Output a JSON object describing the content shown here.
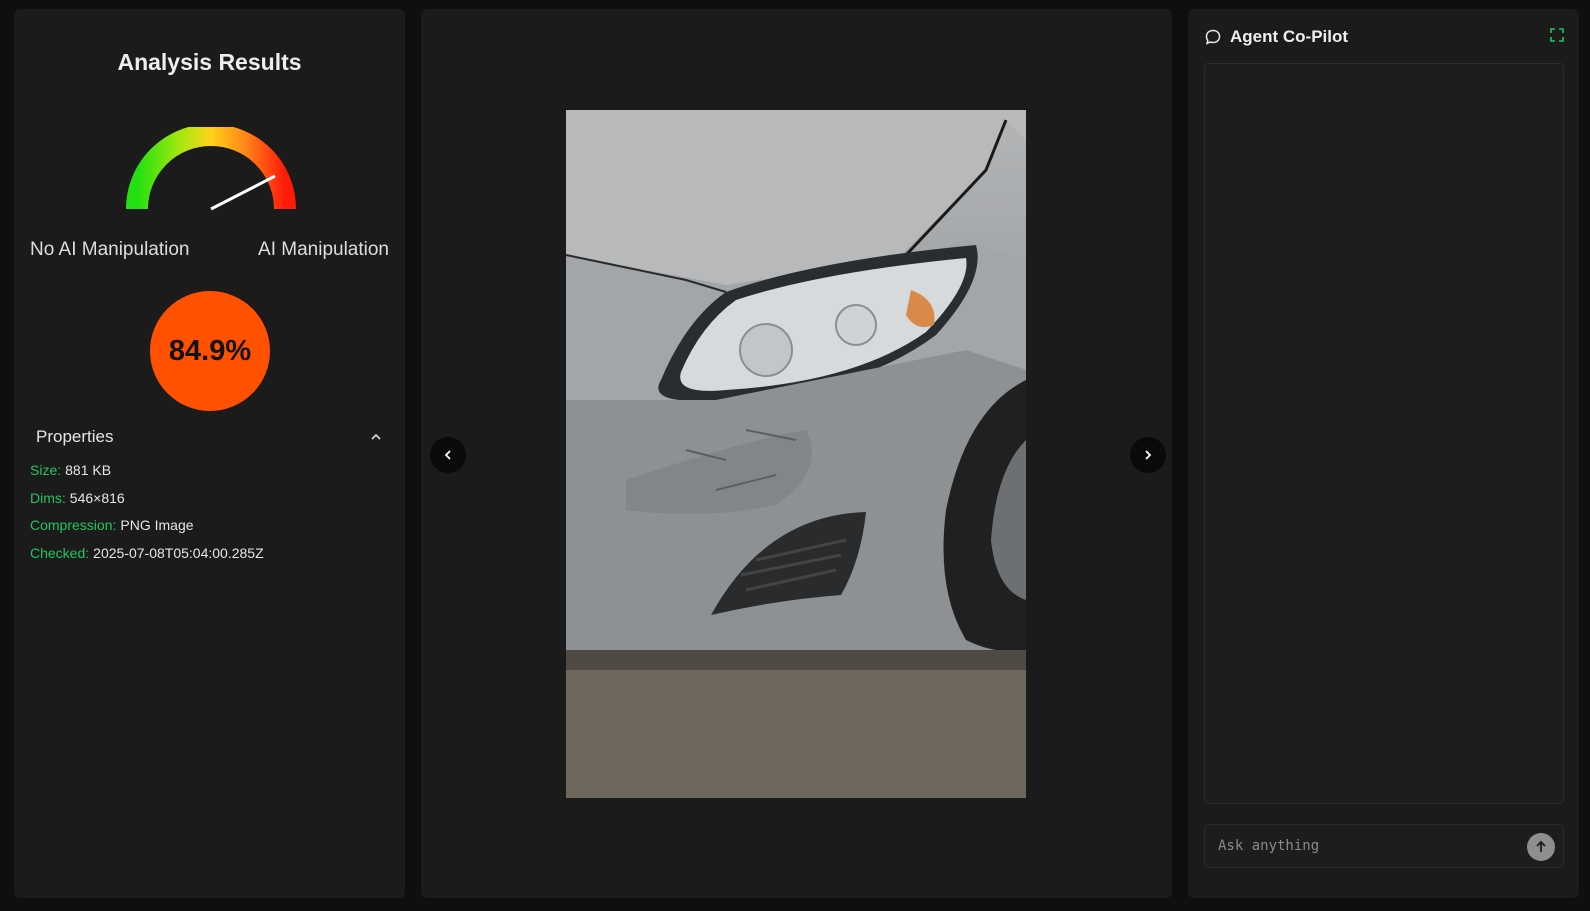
{
  "analysis": {
    "title": "Analysis Results",
    "gauge": {
      "left_label": "No AI Manipulation",
      "right_label": "AI Manipulation",
      "fraction": 0.849
    },
    "score": "84.9%",
    "score_color": "#ff5100"
  },
  "properties": {
    "header": "Properties",
    "items": [
      {
        "key": "Size:",
        "value": "881 KB"
      },
      {
        "key": "Dims:",
        "value": "546×816"
      },
      {
        "key": "Compression:",
        "value": "PNG Image"
      },
      {
        "key": "Checked:",
        "value": "2025-07-08T05:04:00.285Z"
      }
    ]
  },
  "viewer": {
    "image_icon": "damaged-car-photo",
    "prev_icon": "chevron-left-icon",
    "next_icon": "chevron-right-icon"
  },
  "copilot": {
    "title": "Agent Co-Pilot",
    "input_placeholder": "Ask anything",
    "input_value": "",
    "accent": "#22c55e"
  }
}
